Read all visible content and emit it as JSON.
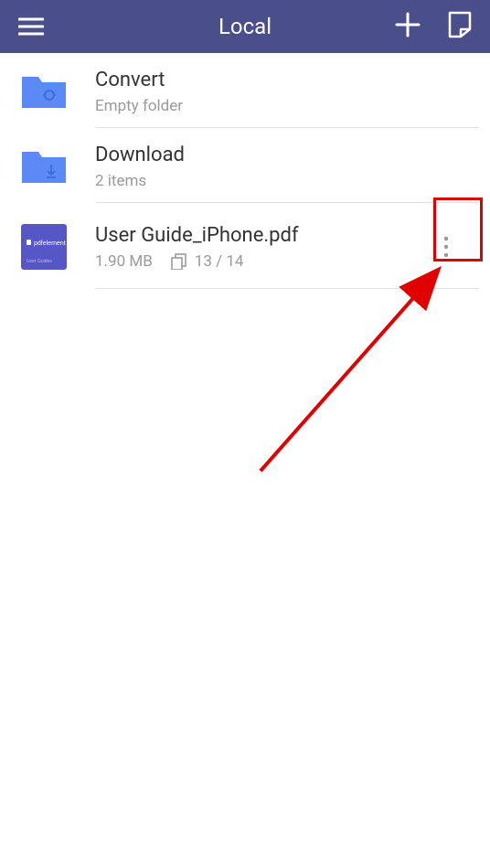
{
  "header": {
    "title": "Local"
  },
  "items": [
    {
      "kind": "folder",
      "icon": "sync-folder",
      "name": "Convert",
      "meta": "Empty folder"
    },
    {
      "kind": "folder",
      "icon": "download-folder",
      "name": "Download",
      "meta": "2 items"
    },
    {
      "kind": "file",
      "icon": "pdf",
      "name": "User Guide_iPhone.pdf",
      "size": "1.90 MB",
      "pages": "13 / 14",
      "has_more": true
    }
  ],
  "colors": {
    "header_bg": "#4a4e8a",
    "accent_blue": "#5b89f5",
    "pdf_bg": "#5656c7",
    "text_gray": "#9a9a9a",
    "annotation_red": "#e00000"
  }
}
